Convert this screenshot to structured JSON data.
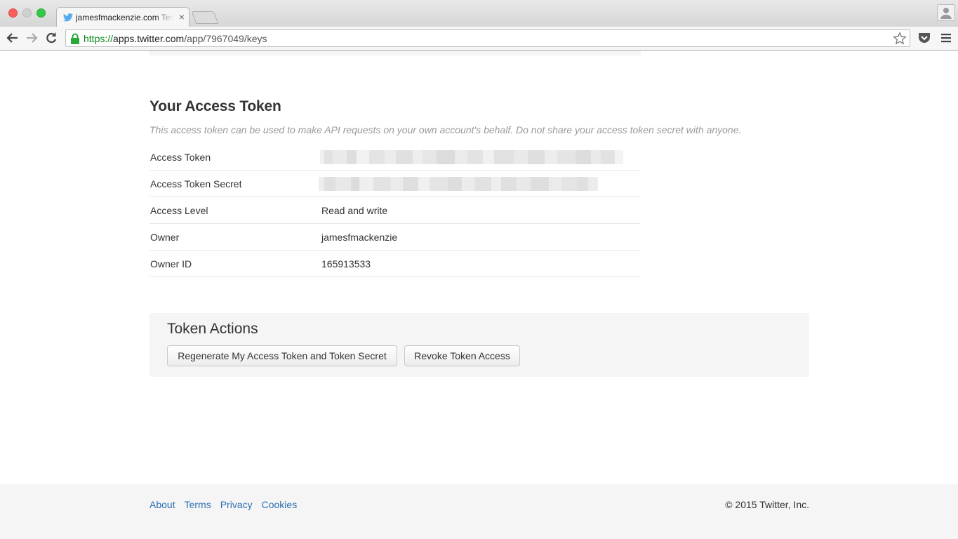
{
  "browser": {
    "tab_title": "jamesfmackenzie.com Test",
    "tab_close": "×",
    "url_scheme": "https://",
    "url_host": "apps.twitter.com",
    "url_path": "/app/7967049/keys"
  },
  "access_token": {
    "title": "Your Access Token",
    "description": "This access token can be used to make API requests on your own account's behalf. Do not share your access token secret with anyone.",
    "rows": [
      {
        "label": "Access Token",
        "value": null
      },
      {
        "label": "Access Token Secret",
        "value": null
      },
      {
        "label": "Access Level",
        "value": "Read and write"
      },
      {
        "label": "Owner",
        "value": "jamesfmackenzie"
      },
      {
        "label": "Owner ID",
        "value": "165913533"
      }
    ]
  },
  "token_actions": {
    "title": "Token Actions",
    "regenerate_label": "Regenerate My Access Token and Token Secret",
    "revoke_label": "Revoke Token Access"
  },
  "footer": {
    "links": [
      "About",
      "Terms",
      "Privacy",
      "Cookies"
    ],
    "copyright": "© 2015 Twitter, Inc."
  },
  "colors": {
    "link": "#2a6fb0",
    "panel_bg": "#f5f5f5",
    "secure_green": "#0a8a1a"
  }
}
